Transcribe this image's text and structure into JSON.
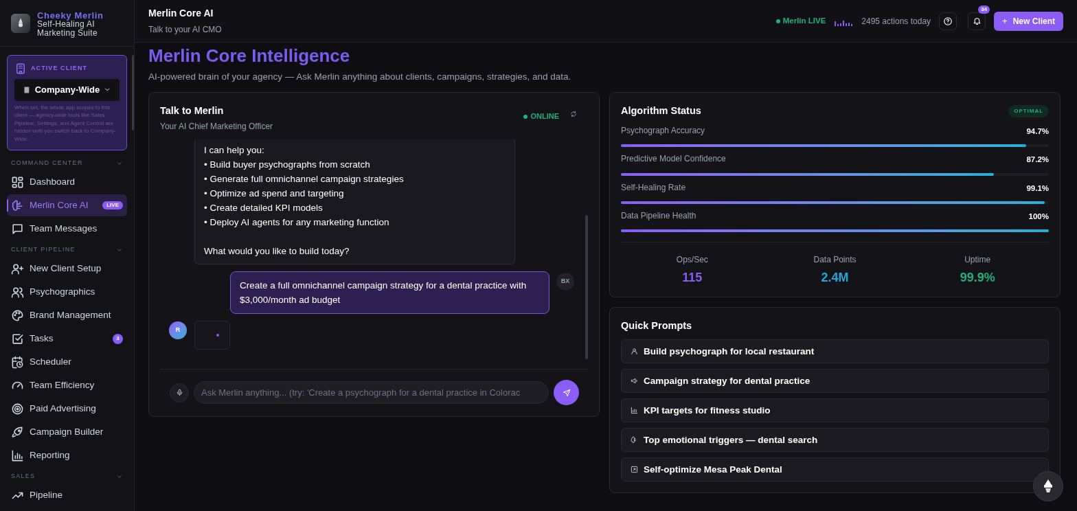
{
  "brand": {
    "name": "Cheeky Merlin",
    "tagline": "Self-Healing AI Marketing Suite"
  },
  "active_client": {
    "label": "ACTIVE CLIENT",
    "value": "Company-Wide",
    "note": "When set, the whole app scopes to this client — agency-wide tools like Sales Pipeline, Settings, and Agent Control are hidden until you switch back to Company-Wide."
  },
  "sidebar": {
    "sections": [
      {
        "title": "COMMAND CENTER",
        "expanded": true,
        "items": [
          {
            "label": "Dashboard",
            "selected": false
          },
          {
            "label": "Merlin Core AI",
            "selected": true,
            "badge": "LIVE"
          },
          {
            "label": "Team Messages",
            "selected": false
          }
        ]
      },
      {
        "title": "CLIENT PIPELINE",
        "expanded": true,
        "items": [
          {
            "label": "New Client Setup",
            "selected": false
          },
          {
            "label": "Psychographics",
            "selected": false
          },
          {
            "label": "Brand Management",
            "selected": false
          },
          {
            "label": "Tasks",
            "selected": false,
            "count": "3"
          },
          {
            "label": "Scheduler",
            "selected": false
          },
          {
            "label": "Team Efficiency",
            "selected": false
          },
          {
            "label": "Paid Advertising",
            "selected": false
          },
          {
            "label": "Campaign Builder",
            "selected": false
          },
          {
            "label": "Reporting",
            "selected": false
          }
        ]
      },
      {
        "title": "SALES",
        "expanded": true,
        "items": [
          {
            "label": "Pipeline",
            "selected": false
          }
        ]
      }
    ]
  },
  "header": {
    "title": "Merlin Core AI",
    "subtitle": "Talk to your AI CMO",
    "status": "Merlin LIVE",
    "actions": "2495 actions today",
    "notifications": "34",
    "new_button": "New Client",
    "new_icon": "+"
  },
  "page": {
    "title": "Merlin Core Intelligence",
    "subtitle": "AI-powered brain of your agency — Ask Merlin anything about clients, campaigns, strategies, and data."
  },
  "chat": {
    "title": "Talk to Merlin",
    "subtitle": "Your AI Chief Marketing Officer",
    "status": "ONLINE",
    "messages": [
      {
        "kind": "assistant",
        "intro": "I can help you:",
        "bullets": [
          "• Build buyer psychographs from scratch",
          "• Generate full omnichannel campaign strategies",
          "• Optimize ad spend and targeting",
          "• Create detailed KPI models",
          "• Deploy AI agents for any marketing function"
        ],
        "closing": "What would you like to build today?"
      },
      {
        "kind": "user",
        "text": "Create a full omnichannel campaign strategy for a dental practice with $3,000/month ad budget",
        "avatar": "BX"
      },
      {
        "kind": "typing",
        "avatar": "R"
      }
    ],
    "input": {
      "placeholder": "Ask Merlin anything... (try: 'Create a psychograph for a dental practice in Colorac"
    }
  },
  "algorithm": {
    "title": "Algorithm Status",
    "badge": "OPTIMAL",
    "metrics": [
      {
        "name": "Psychograph Accuracy",
        "reading": "94.7%",
        "level": 0.947
      },
      {
        "name": "Predictive Model Confidence",
        "reading": "87.2%",
        "level": 0.872
      },
      {
        "name": "Self-Healing Rate",
        "reading": "99.1%",
        "level": 0.991
      },
      {
        "name": "Data Pipeline Health",
        "reading": "100%",
        "level": 1
      }
    ],
    "stats": [
      {
        "label": "Ops/Sec",
        "value": "115",
        "color": "#8b5cf6"
      },
      {
        "label": "Data Points",
        "value": "2.4M",
        "color": "#22a7d6"
      },
      {
        "label": "Uptime",
        "value": "99.9%",
        "color": "#22b07d"
      }
    ]
  },
  "quick_prompts": {
    "title": "Quick Prompts",
    "items": [
      "Build psychograph for local restaurant",
      "Campaign strategy for dental practice",
      "KPI targets for fitness studio",
      "Top emotional triggers — dental search",
      "Self-optimize Mesa Peak Dental"
    ]
  }
}
